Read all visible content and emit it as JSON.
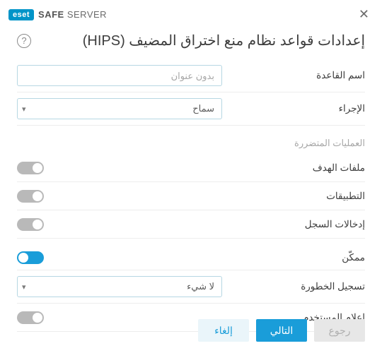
{
  "brand": {
    "logo": "eset",
    "product_a": "SAFE",
    "product_b": "SERVER"
  },
  "title": "إعدادات قواعد نظام منع اختراق المضيف (HIPS)",
  "fields": {
    "rule_name": {
      "label": "اسم القاعدة",
      "placeholder": "بدون عنوان"
    },
    "action": {
      "label": "الإجراء",
      "value": "سماح"
    }
  },
  "affected": {
    "header": "العمليات المتضررة",
    "target_files": {
      "label": "ملفات الهدف",
      "on": false
    },
    "applications": {
      "label": "التطبيقات",
      "on": false
    },
    "registry": {
      "label": "إدخالات السجل",
      "on": false
    }
  },
  "options": {
    "enabled": {
      "label": "ممكّن",
      "on": true
    },
    "severity": {
      "label": "تسجيل الخطورة",
      "value": "لا شيء"
    },
    "notify_user": {
      "label": "إعلام المستخدم",
      "on": false
    }
  },
  "buttons": {
    "back": "رجوع",
    "next": "التالي",
    "cancel": "إلغاء"
  }
}
